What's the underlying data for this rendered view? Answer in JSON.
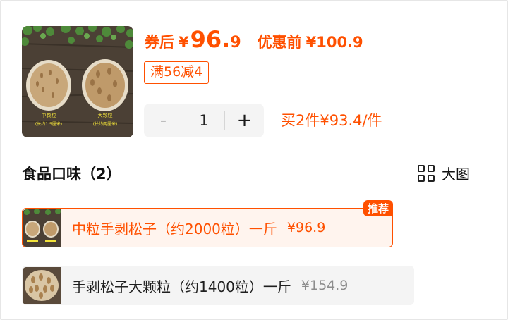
{
  "price": {
    "after_coupon_label": "券后",
    "currency": "¥",
    "after_coupon_int": "96.",
    "after_coupon_dec": "9",
    "before_label": "优惠前",
    "before_value": "¥100.9"
  },
  "coupon": {
    "text": "满56减4"
  },
  "stepper": {
    "minus": "-",
    "quantity": "1",
    "plus": "+"
  },
  "bulk_offer": {
    "text": "买2件¥93.4/件"
  },
  "section": {
    "title": "食品口味（2）",
    "view_toggle": "大图"
  },
  "options": [
    {
      "name": "中粒手剥松子（约2000粒）一斤",
      "price": "¥96.9",
      "tag": "推荐",
      "selected": true
    },
    {
      "name": "手剥松子大颗粒（约1400粒）一斤",
      "price": "¥154.9",
      "selected": false
    }
  ],
  "thumbnail": {
    "left_caption_1": "中颗粒",
    "left_caption_2": "(长约1.5厘米)",
    "right_caption_1": "大颗粒",
    "right_caption_2": "(长约两厘米)"
  },
  "colors": {
    "accent": "#ff5000",
    "selected_bg": "#fff4ee",
    "option_bg": "#f4f4f4"
  },
  "icons": {
    "view_toggle": "grid-icon"
  }
}
